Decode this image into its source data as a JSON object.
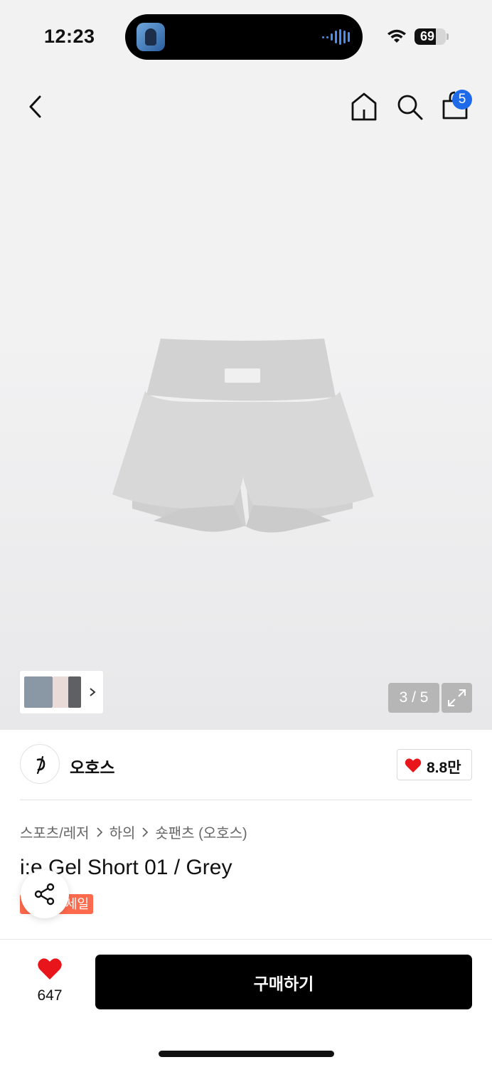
{
  "status_bar": {
    "time": "12:23",
    "battery": "69",
    "battery_level_percent": 69,
    "icons": [
      "app-icon",
      "audio-wave-icon",
      "wifi-icon",
      "battery-icon"
    ]
  },
  "nav": {
    "icons": [
      "back-arrow-icon",
      "home-icon",
      "search-icon",
      "shopping-bag-icon"
    ],
    "cart_count": "5"
  },
  "gallery": {
    "page_indicator": "3 / 5",
    "thumbnail_colors": [
      "#8a98a6",
      "#e9dcd8",
      "#5e6063"
    ],
    "product_color": "#d9d9d9"
  },
  "brand": {
    "name": "오호스",
    "like_count": "8.8만"
  },
  "product": {
    "breadcrumb": [
      "스포츠/레저",
      "하의",
      "숏팬츠 (오호스)"
    ],
    "title": "i:e Gel Short 01 / Grey",
    "badge": "세일"
  },
  "bottom_bar": {
    "like_count": "647",
    "buy_label": "구매하기"
  },
  "colors": {
    "accent_badge": "#1f6ae8",
    "heart": "#e8151b",
    "sale": "#ff6a4d",
    "buy_button": "#000000"
  }
}
